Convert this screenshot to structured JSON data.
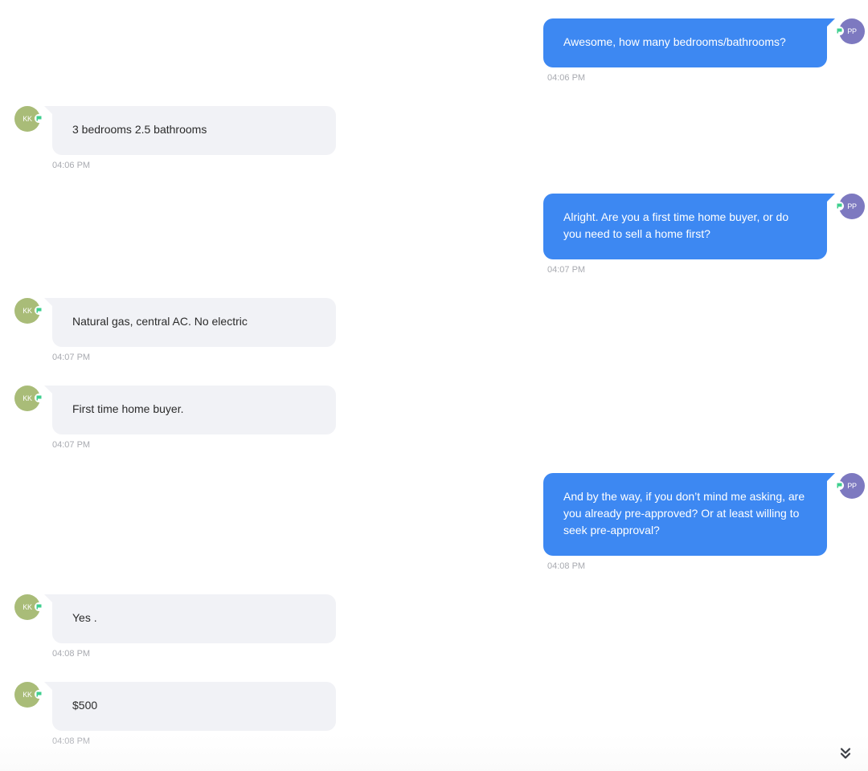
{
  "colors": {
    "outgoing_bubble": "#3d88f2",
    "incoming_bubble": "#f1f2f6",
    "outgoing_avatar": "#7d79c0",
    "incoming_avatar": "#a9bc78",
    "message_badge": "#3ecf8e"
  },
  "messages": [
    {
      "direction": "outgoing",
      "sender_initials": "PP",
      "text": "Awesome, how many bedrooms/bathrooms?",
      "time": "04:06 PM"
    },
    {
      "direction": "incoming",
      "sender_initials": "KK",
      "text": "3 bedrooms 2.5 bathrooms",
      "time": "04:06 PM"
    },
    {
      "direction": "outgoing",
      "sender_initials": "PP",
      "text": "Alright. Are you a first time home buyer, or do you need to sell a home first?",
      "time": "04:07 PM"
    },
    {
      "direction": "incoming",
      "sender_initials": "KK",
      "text": "Natural gas, central AC. No electric",
      "time": "04:07 PM"
    },
    {
      "direction": "incoming",
      "sender_initials": "KK",
      "text": "First time home buyer.",
      "time": "04:07 PM"
    },
    {
      "direction": "outgoing",
      "sender_initials": "PP",
      "text": "And by the way, if you don’t mind me asking, are you already pre-approved? Or at least willing to seek pre-approval?",
      "time": "04:08 PM"
    },
    {
      "direction": "incoming",
      "sender_initials": "KK",
      "text": "Yes .",
      "time": "04:08 PM"
    },
    {
      "direction": "incoming",
      "sender_initials": "KK",
      "text": "$500",
      "time": "04:08 PM"
    }
  ],
  "icons": {
    "message_badge": "message-flag-icon",
    "scroll_bottom": "double-chevron-down-icon"
  }
}
